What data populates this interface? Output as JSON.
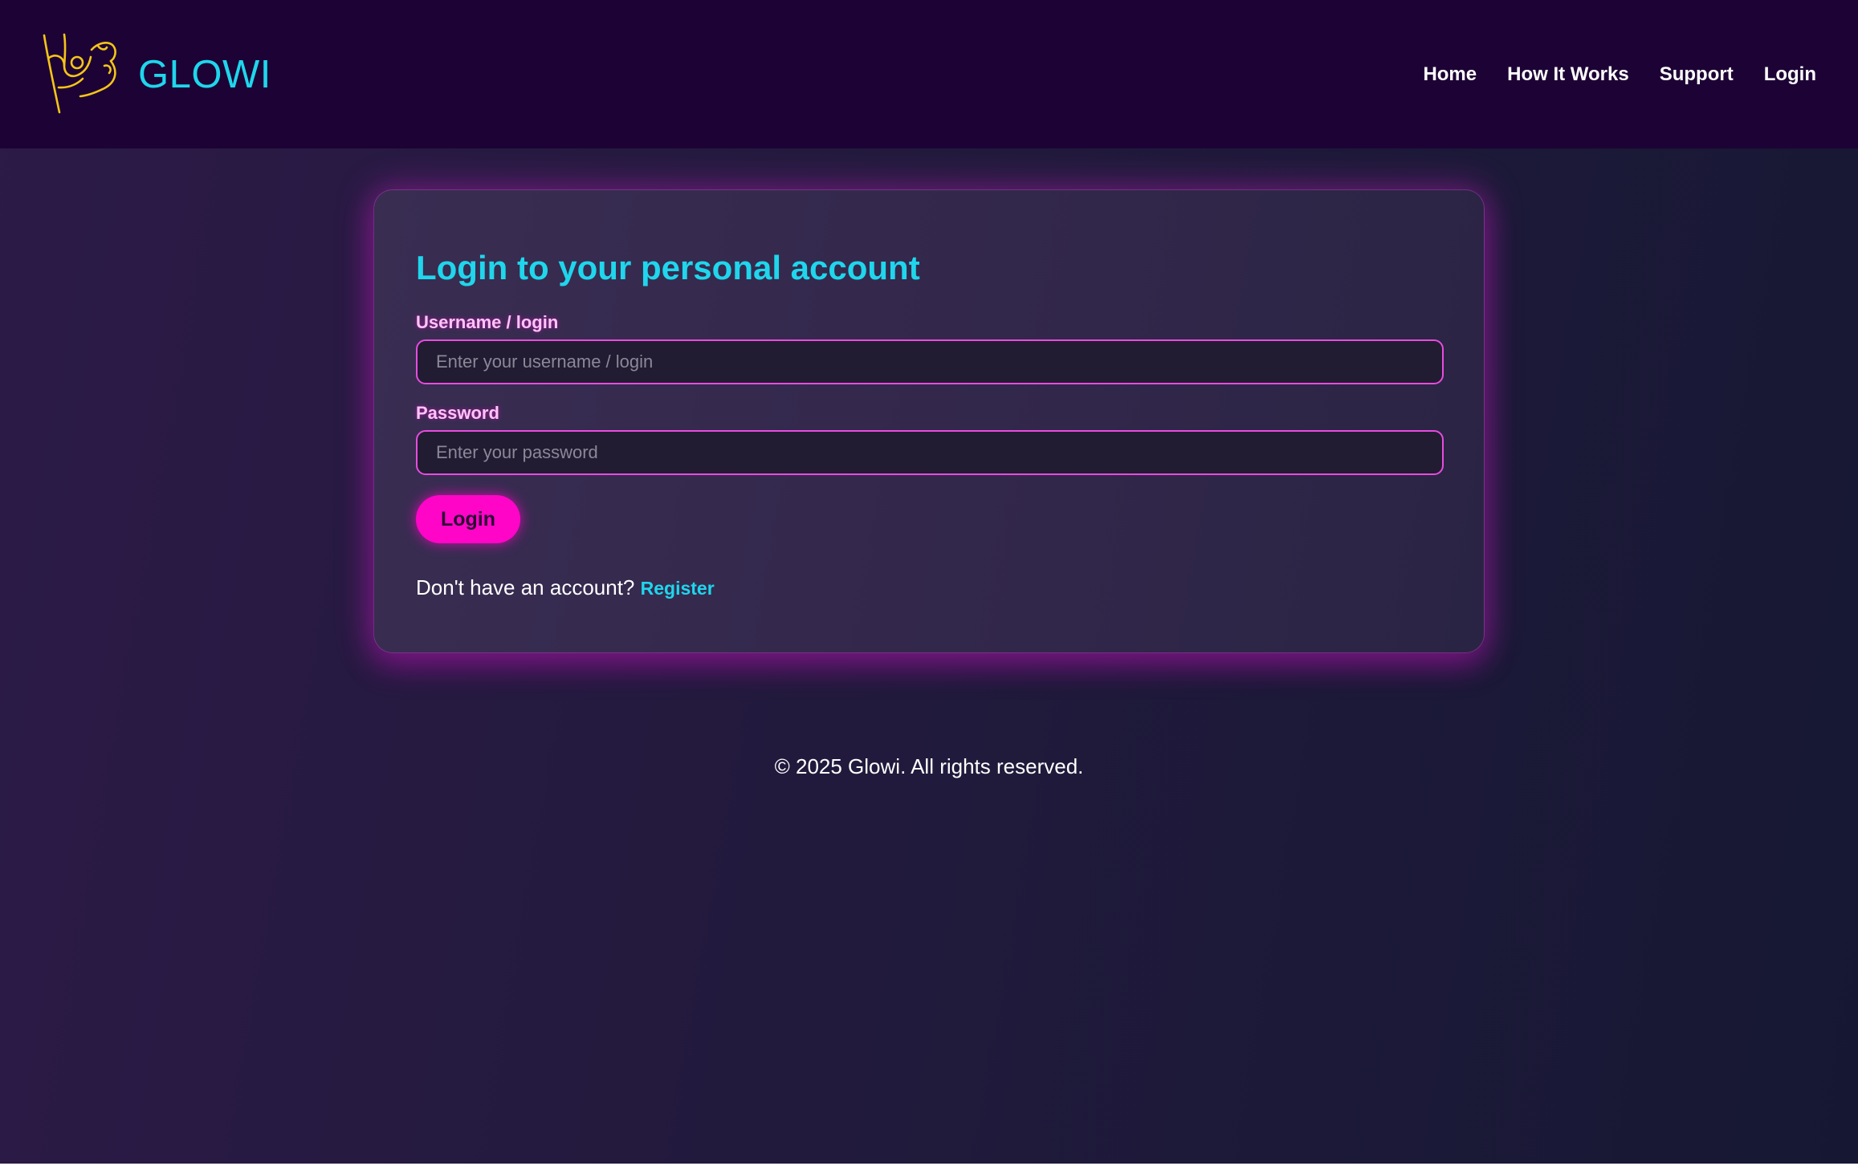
{
  "header": {
    "brand_name": "GLOWI",
    "logo_icon": "dancer-sketch-icon",
    "nav": [
      {
        "label": "Home"
      },
      {
        "label": "How It Works"
      },
      {
        "label": "Support"
      },
      {
        "label": "Login"
      }
    ]
  },
  "login_form": {
    "title": "Login to your personal account",
    "username_label": "Username / login",
    "username_placeholder": "Enter your username / login",
    "username_value": "",
    "password_label": "Password",
    "password_placeholder": "Enter your password",
    "password_value": "",
    "submit_label": "Login",
    "no_account_text": "Don't have an account?",
    "register_link": "Register"
  },
  "footer": {
    "copyright": "© 2025 Glowi. All rights reserved."
  },
  "colors": {
    "accent_cyan": "#1fd6ec",
    "accent_magenta": "#ff05c8",
    "header_bg": "#1d0335",
    "logo_yellow": "#f5c518"
  }
}
